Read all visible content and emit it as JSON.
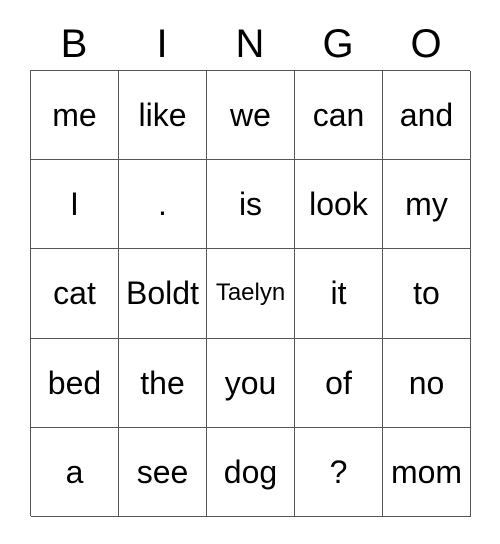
{
  "card": {
    "type": "bingo-card",
    "columns": 5,
    "rows": 5,
    "background_color": "#ffffff",
    "text_color": "#000000",
    "grid_line_color": "#555555",
    "header": {
      "letters": [
        {
          "label": "B"
        },
        {
          "label": "I"
        },
        {
          "label": "N"
        },
        {
          "label": "G"
        },
        {
          "label": "O"
        }
      ]
    },
    "grid": {
      "rows": [
        {
          "cells": [
            {
              "text": "me",
              "size": "normal"
            },
            {
              "text": "like",
              "size": "normal"
            },
            {
              "text": "we",
              "size": "normal"
            },
            {
              "text": "can",
              "size": "normal"
            },
            {
              "text": "and",
              "size": "normal"
            }
          ]
        },
        {
          "cells": [
            {
              "text": "I",
              "size": "normal"
            },
            {
              "text": ".",
              "size": "normal"
            },
            {
              "text": "is",
              "size": "normal"
            },
            {
              "text": "look",
              "size": "normal"
            },
            {
              "text": "my",
              "size": "normal"
            }
          ]
        },
        {
          "cells": [
            {
              "text": "cat",
              "size": "normal"
            },
            {
              "text": "Boldt",
              "size": "normal"
            },
            {
              "text": "Taelyn",
              "size": "small"
            },
            {
              "text": "it",
              "size": "normal"
            },
            {
              "text": "to",
              "size": "normal"
            }
          ]
        },
        {
          "cells": [
            {
              "text": "bed",
              "size": "normal"
            },
            {
              "text": "the",
              "size": "normal"
            },
            {
              "text": "you",
              "size": "normal"
            },
            {
              "text": "of",
              "size": "normal"
            },
            {
              "text": "no",
              "size": "normal"
            }
          ]
        },
        {
          "cells": [
            {
              "text": "a",
              "size": "normal"
            },
            {
              "text": "see",
              "size": "normal"
            },
            {
              "text": "dog",
              "size": "normal"
            },
            {
              "text": "?",
              "size": "normal"
            },
            {
              "text": "mom",
              "size": "normal"
            }
          ]
        }
      ]
    }
  }
}
